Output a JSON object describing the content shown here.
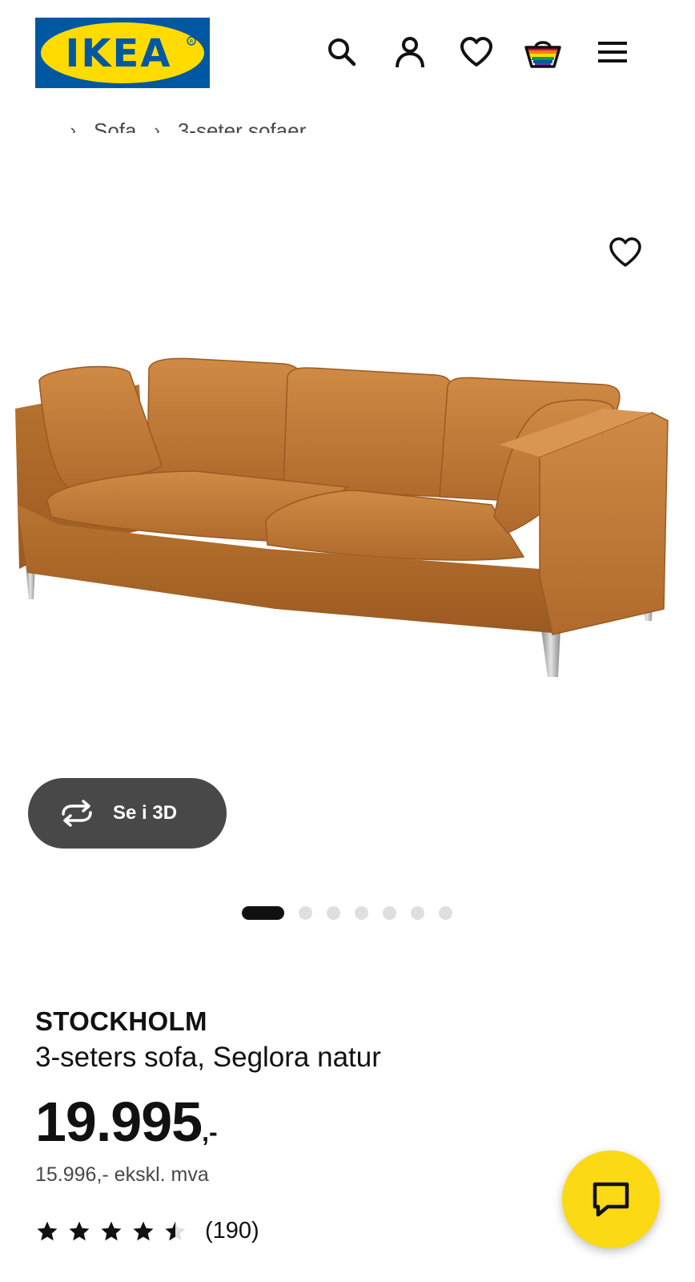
{
  "header": {
    "logo_text": "IKEA",
    "icons": [
      "search-icon",
      "user-icon",
      "heart-icon",
      "cart-icon",
      "menu-icon"
    ],
    "brand_blue": "#0058a3",
    "brand_yellow": "#ffdb00"
  },
  "breadcrumb": {
    "items": [
      "...",
      "Sofa",
      "3-seter sofaer"
    ]
  },
  "gallery": {
    "favorite_icon": "heart-icon",
    "view_3d_label": "Se i 3D",
    "view_3d_icon": "rotate-icon",
    "image_count": 7,
    "active_index": 0
  },
  "product": {
    "name": "STOCKHOLM",
    "description": "3-seters sofa, Seglora natur",
    "price": "19.995",
    "price_suffix": ",-",
    "price_ex_vat": "15.996,- ekskl. mva",
    "rating": 4.5,
    "rating_max": 5,
    "review_count": "(190)"
  },
  "chat": {
    "icon": "chat-icon",
    "color": "#fbd914"
  }
}
